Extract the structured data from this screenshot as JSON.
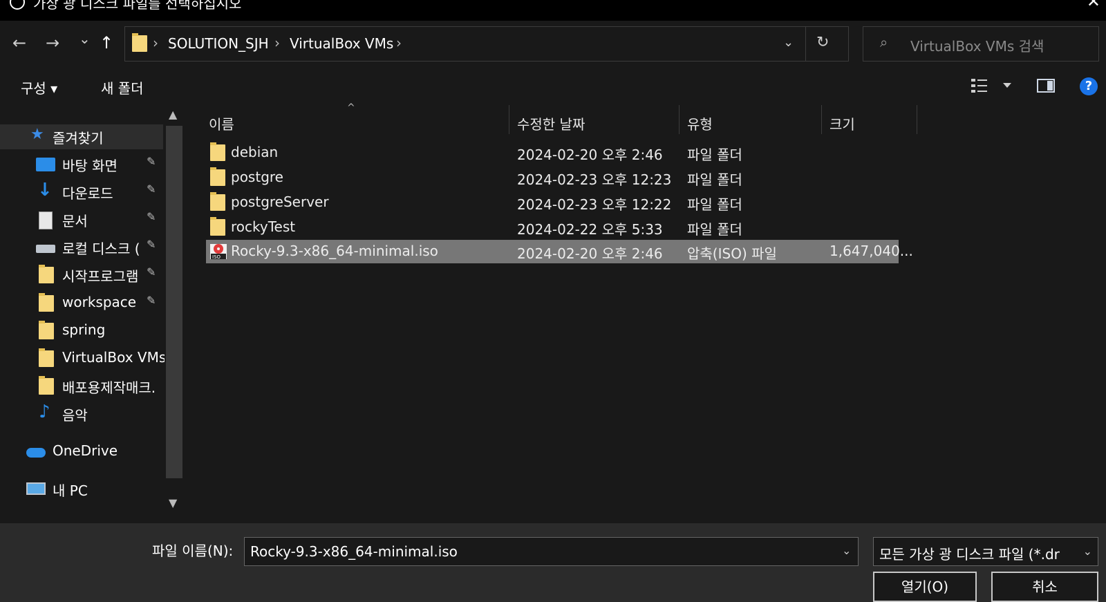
{
  "window": {
    "title": "가상 광 디스크 파일를 선택하십시오",
    "close": "✕"
  },
  "nav": {
    "back": "←",
    "forward": "→",
    "recent": "⌄",
    "up": "↑",
    "breadcrumb": [
      "SOLUTION_SJH",
      "VirtualBox VMs"
    ],
    "sep": "›",
    "dropdown": "⌄",
    "refresh": "↻",
    "search_placeholder": "VirtualBox VMs 검색"
  },
  "toolbar": {
    "organize": "구성 ▾",
    "new_folder": "새 폴더",
    "help": "?"
  },
  "sidebar": {
    "items": [
      {
        "label": "즐겨찾기",
        "icon": "star-icon",
        "pinned": false
      },
      {
        "label": "바탕 화면",
        "icon": "desktop-icon",
        "pinned": true
      },
      {
        "label": "다운로드",
        "icon": "download-icon",
        "pinned": true
      },
      {
        "label": "문서",
        "icon": "document-icon",
        "pinned": true
      },
      {
        "label": "로컬 디스크 (",
        "icon": "drive-icon",
        "pinned": true
      },
      {
        "label": "시작프로그램",
        "icon": "folder-icon",
        "pinned": true
      },
      {
        "label": "workspace",
        "icon": "folder-icon",
        "pinned": true
      },
      {
        "label": "spring",
        "icon": "folder-icon",
        "pinned": false
      },
      {
        "label": "VirtualBox VMs",
        "icon": "folder-icon",
        "pinned": false
      },
      {
        "label": "배포용제작매크.",
        "icon": "folder-icon",
        "pinned": false
      },
      {
        "label": "음악",
        "icon": "music-icon",
        "pinned": false
      },
      {
        "label": "OneDrive",
        "icon": "cloud-icon",
        "pinned": false
      },
      {
        "label": "내 PC",
        "icon": "pc-icon",
        "pinned": false
      }
    ],
    "pin_glyph": "📌"
  },
  "columns": {
    "name": "이름",
    "modified": "수정한 날짜",
    "type": "유형",
    "size": "크기"
  },
  "files": [
    {
      "name": "debian",
      "modified": "2024-02-20 오후 2:46",
      "type": "파일 폴더",
      "size": "",
      "icon": "folder-icon"
    },
    {
      "name": "postgre",
      "modified": "2024-02-23 오후 12:23",
      "type": "파일 폴더",
      "size": "",
      "icon": "folder-icon"
    },
    {
      "name": "postgreServer",
      "modified": "2024-02-23 오후 12:22",
      "type": "파일 폴더",
      "size": "",
      "icon": "folder-icon"
    },
    {
      "name": "rockyTest",
      "modified": "2024-02-22 오후 5:33",
      "type": "파일 폴더",
      "size": "",
      "icon": "folder-icon"
    },
    {
      "name": "Rocky-9.3-x86_64-minimal.iso",
      "modified": "2024-02-20 오후 2:46",
      "type": "압축(ISO) 파일",
      "size": "1,647,040...",
      "icon": "iso-icon",
      "selected": true
    }
  ],
  "footer": {
    "filename_label": "파일 이름(N):",
    "filename_value": "Rocky-9.3-x86_64-minimal.iso",
    "filetype_value": "모든 가상 광 디스크 파일 (*.dr",
    "open_label": "열기(O)",
    "cancel_label": "취소"
  },
  "colors": {
    "background": "#191919",
    "selection": "#777777",
    "folder": "#f6d77d",
    "accent": "#1a73e8"
  }
}
